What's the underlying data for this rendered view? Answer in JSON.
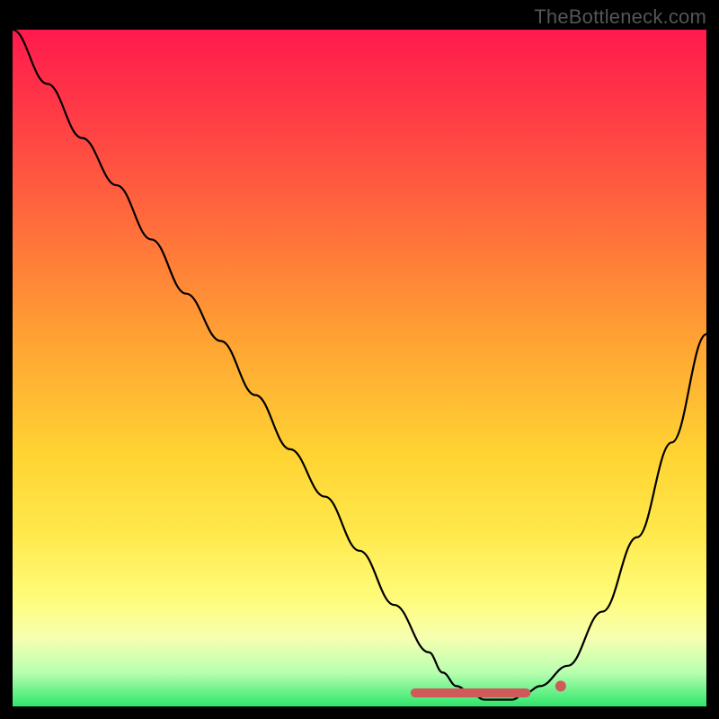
{
  "watermark": "TheBottleneck.com",
  "chart_data": {
    "type": "line",
    "title": "",
    "xlabel": "",
    "ylabel": "",
    "xlim": [
      0,
      100
    ],
    "ylim": [
      0,
      100
    ],
    "series": [
      {
        "name": "bottleneck-curve",
        "x": [
          0,
          5,
          10,
          15,
          20,
          25,
          30,
          35,
          40,
          45,
          50,
          55,
          60,
          62,
          64,
          66,
          68,
          70,
          72,
          74,
          76,
          80,
          85,
          90,
          95,
          100
        ],
        "y": [
          100,
          92,
          84,
          77,
          69,
          61,
          54,
          46,
          38,
          31,
          23,
          15,
          8,
          5,
          3,
          2,
          1,
          1,
          1,
          2,
          3,
          6,
          14,
          25,
          39,
          55
        ]
      }
    ],
    "markers": [
      {
        "name": "flat-region-start",
        "x": 60,
        "y": 2,
        "color": "#d05a5a"
      },
      {
        "name": "flat-region-mid",
        "x": 66,
        "y": 1,
        "color": "#d05a5a"
      },
      {
        "name": "flat-region-end",
        "x": 72,
        "y": 2,
        "color": "#d05a5a"
      },
      {
        "name": "optimum-point",
        "x": 79,
        "y": 3,
        "color": "#d05a5a"
      }
    ],
    "flat_region": {
      "x_start": 58,
      "x_end": 74,
      "y": 2,
      "color": "#d05a5a"
    },
    "gradient_stops": [
      {
        "pos": 0.0,
        "color": "#ff1a4d"
      },
      {
        "pos": 0.28,
        "color": "#ff6a3c"
      },
      {
        "pos": 0.63,
        "color": "#ffd433"
      },
      {
        "pos": 0.84,
        "color": "#fffc7a"
      },
      {
        "pos": 0.95,
        "color": "#b8ffb0"
      },
      {
        "pos": 1.0,
        "color": "#2ee66a"
      }
    ]
  }
}
